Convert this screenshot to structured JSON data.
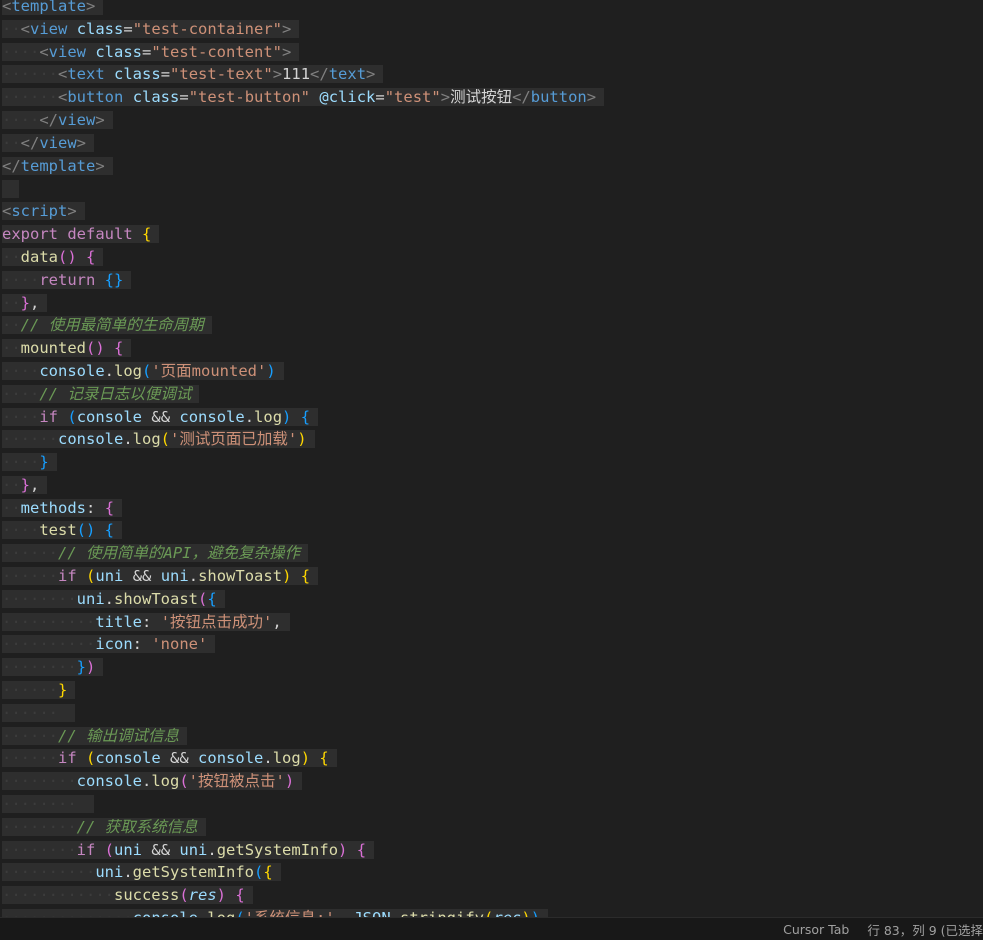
{
  "lines": [
    {
      "text": "<template>"
    },
    {
      "text": "  <view class=\"test-container\">"
    },
    {
      "text": "    <view class=\"test-content\">"
    },
    {
      "text": "      <text class=\"test-text\">111</text>"
    },
    {
      "text": "      <button class=\"test-button\" @click=\"test\">测试按钮</button>"
    },
    {
      "text": "    </view>"
    },
    {
      "text": "  </view>"
    },
    {
      "text": "</template>"
    },
    {
      "text": ""
    },
    {
      "text": "<script>"
    },
    {
      "text": "export default {"
    },
    {
      "text": "  data() {"
    },
    {
      "text": "    return {}"
    },
    {
      "text": "  },"
    },
    {
      "text": "  // 使用最简单的生命周期"
    },
    {
      "text": "  mounted() {"
    },
    {
      "text": "    console.log('页面mounted')"
    },
    {
      "text": "    // 记录日志以便调试"
    },
    {
      "text": "    if (console && console.log) {"
    },
    {
      "text": "      console.log('测试页面已加载')"
    },
    {
      "text": "    }"
    },
    {
      "text": "  },"
    },
    {
      "text": "  methods: {"
    },
    {
      "text": "    test() {"
    },
    {
      "text": "      // 使用简单的API, 避免复杂操作"
    },
    {
      "text": "      if (uni && uni.showToast) {"
    },
    {
      "text": "        uni.showToast({"
    },
    {
      "text": "          title: '按钮点击成功',"
    },
    {
      "text": "          icon: 'none'"
    },
    {
      "text": "        })"
    },
    {
      "text": "      }"
    },
    {
      "text": "      "
    },
    {
      "text": "      // 输出调试信息"
    },
    {
      "text": "      if (console && console.log) {"
    },
    {
      "text": "        console.log('按钮被点击')"
    },
    {
      "text": "        "
    },
    {
      "text": "        // 获取系统信息"
    },
    {
      "text": "        if (uni && uni.getSystemInfo) {"
    },
    {
      "text": "          uni.getSystemInfo({"
    },
    {
      "text": "            success(res) {"
    },
    {
      "text": "              console.log('系统信息:', JSON.stringify(res))"
    }
  ],
  "statusbar": {
    "cursor_tab": "Cursor Tab",
    "position": "行 83，列 9 (已选择"
  }
}
